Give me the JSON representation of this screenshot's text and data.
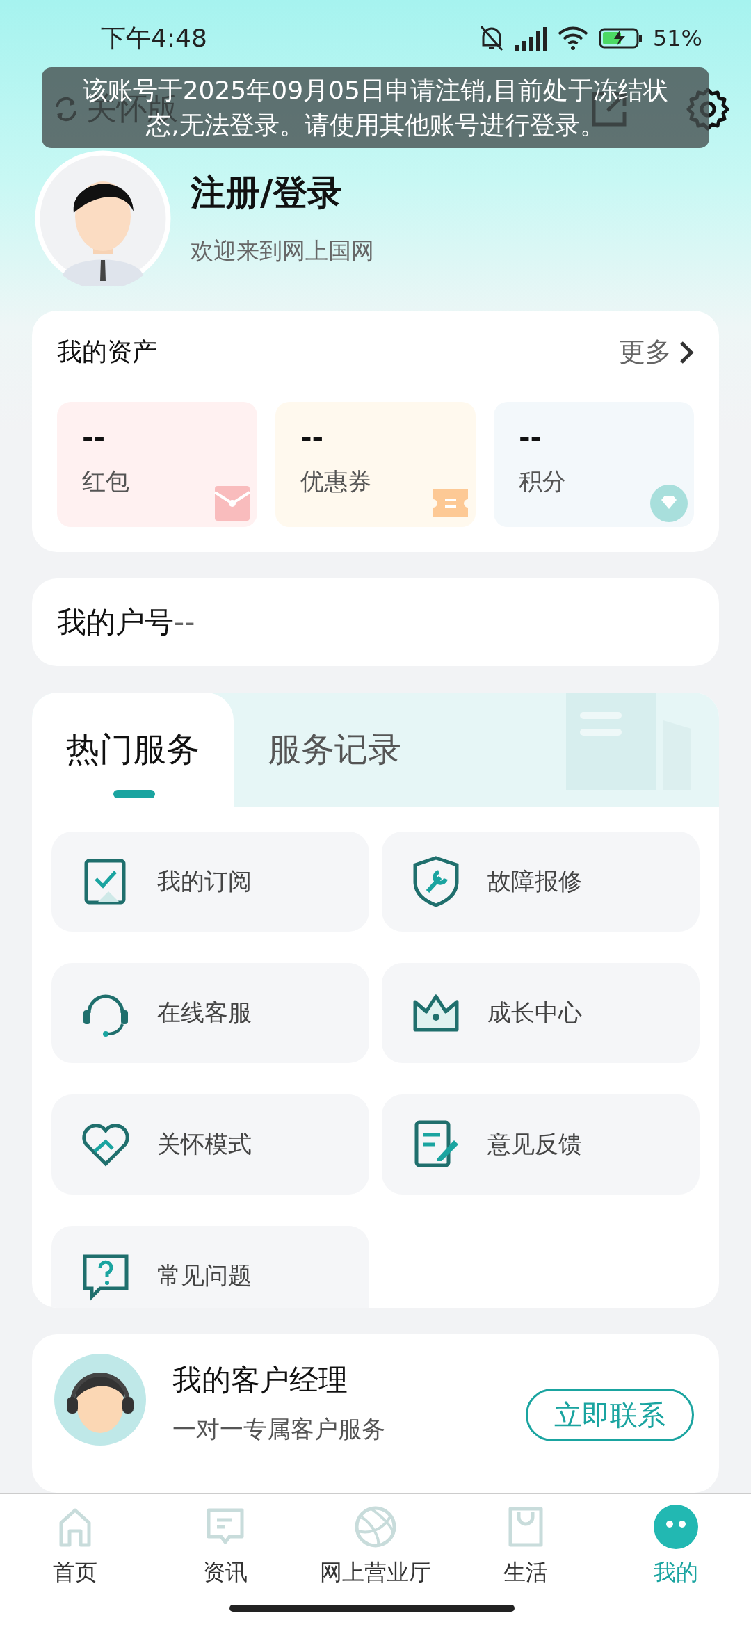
{
  "status_bar": {
    "time": "下午4:48",
    "battery": "51%"
  },
  "header": {
    "care_mode": "关怀版"
  },
  "toast": "该账号于2025年09月05日申请注销,目前处于冻结状态,无法登录。请使用其他账号进行登录。",
  "profile": {
    "name": "注册/登录",
    "subtitle": "欢迎来到网上国网"
  },
  "assets": {
    "title": "我的资产",
    "more": "更多",
    "items": [
      {
        "value": "--",
        "label": "红包",
        "color": "#fff1f1"
      },
      {
        "value": "--",
        "label": "优惠券",
        "color": "#fff9ee"
      },
      {
        "value": "--",
        "label": "积分",
        "color": "#f3f8fb"
      }
    ]
  },
  "account": {
    "label": "我的户号",
    "value": "--"
  },
  "services": {
    "tabs": [
      {
        "label": "热门服务",
        "selected": true
      },
      {
        "label": "服务记录",
        "selected": false
      }
    ],
    "items": [
      {
        "label": "我的订阅"
      },
      {
        "label": "故障报修"
      },
      {
        "label": "在线客服"
      },
      {
        "label": "成长中心"
      },
      {
        "label": "关怀模式"
      },
      {
        "label": "意见反馈"
      },
      {
        "label": "常见问题"
      }
    ]
  },
  "manager": {
    "title": "我的客户经理",
    "subtitle": "一对一专属客户服务",
    "button": "立即联系"
  },
  "nav": [
    {
      "label": "首页",
      "selected": false
    },
    {
      "label": "资讯",
      "selected": false
    },
    {
      "label": "网上营业厅",
      "selected": false
    },
    {
      "label": "生活",
      "selected": false
    },
    {
      "label": "我的",
      "selected": true
    }
  ]
}
